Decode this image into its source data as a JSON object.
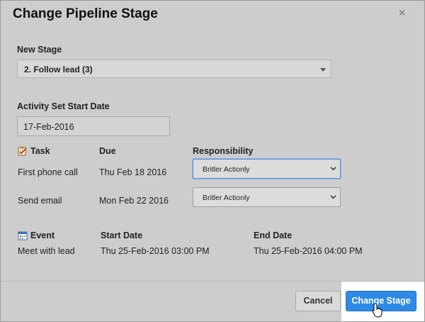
{
  "dialog": {
    "title": "Change Pipeline Stage",
    "close_symbol": "×"
  },
  "new_stage": {
    "label": "New Stage",
    "selected": "2. Follow lead (3)"
  },
  "activity_start": {
    "label": "Activity Set Start Date",
    "value": "17-Feb-2016"
  },
  "tasks": {
    "header_task": "Task",
    "header_due": "Due",
    "header_responsibility": "Responsibility",
    "icon": "task-icon",
    "rows": [
      {
        "name": "First phone call",
        "due": "Thu Feb 18 2016",
        "responsibility": "Britler Actionly"
      },
      {
        "name": "Send email",
        "due": "Mon Feb 22 2016",
        "responsibility": "Britler Actionly"
      }
    ]
  },
  "events": {
    "header_event": "Event",
    "header_start": "Start Date",
    "header_end": "End Date",
    "icon": "calendar-icon",
    "rows": [
      {
        "name": "Meet with lead",
        "start": "Thu 25-Feb-2016 03:00 PM",
        "end": "Thu 25-Feb-2016 04:00 PM"
      }
    ]
  },
  "footer": {
    "cancel_label": "Cancel",
    "submit_label": "Change Stage"
  },
  "colors": {
    "primary": "#2f8ae6",
    "background": "#cdcdcd",
    "focus": "#5b8fd6"
  }
}
